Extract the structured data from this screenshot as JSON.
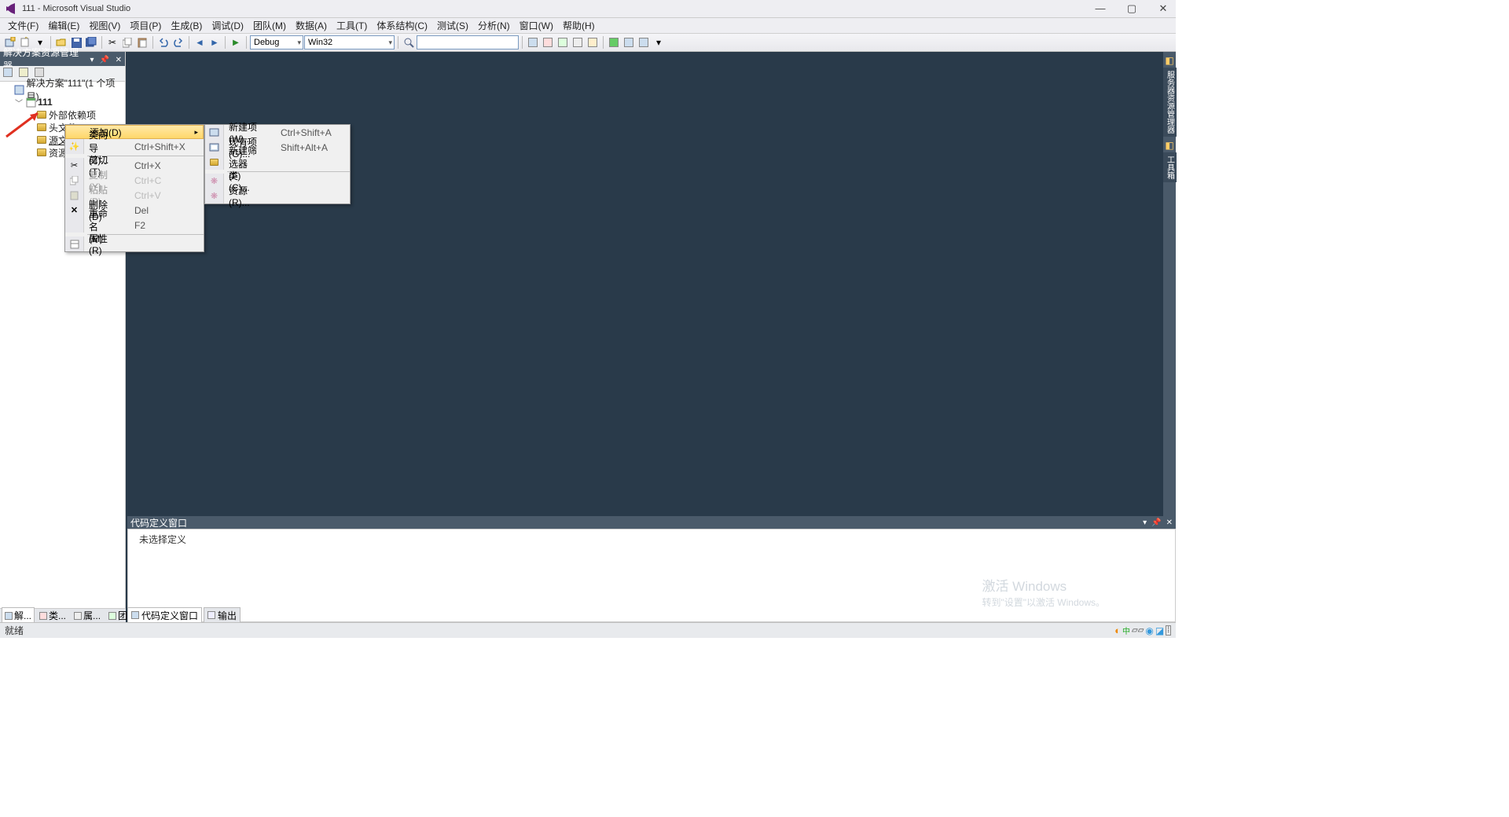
{
  "title": "111 - Microsoft Visual Studio",
  "menubar": [
    "文件(F)",
    "编辑(E)",
    "视图(V)",
    "项目(P)",
    "生成(B)",
    "调试(D)",
    "团队(M)",
    "数据(A)",
    "工具(T)",
    "体系结构(C)",
    "测试(S)",
    "分析(N)",
    "窗口(W)",
    "帮助(H)"
  ],
  "toolbar": {
    "config": "Debug",
    "platform": "Win32"
  },
  "solution_explorer": {
    "title": "解决方案资源管理器",
    "solution": "解决方案\"111\"(1 个项目)",
    "project": "111",
    "folders": [
      "外部依赖项",
      "头文件",
      "源文(",
      "资源"
    ]
  },
  "context_menu_1": [
    {
      "label": "添加(D)",
      "shortcut": "",
      "arrow": true,
      "highlighted": true,
      "icon": ""
    },
    {
      "label": "类向导(Z)...",
      "shortcut": "Ctrl+Shift+X",
      "icon": "wand"
    },
    {
      "sep": true
    },
    {
      "label": "剪切(T)",
      "shortcut": "Ctrl+X",
      "icon": "cut"
    },
    {
      "label": "复制(Y)",
      "shortcut": "Ctrl+C",
      "icon": "copy",
      "disabled": true
    },
    {
      "label": "粘贴(P)",
      "shortcut": "Ctrl+V",
      "icon": "paste",
      "disabled": true
    },
    {
      "label": "删除(D)",
      "shortcut": "Del",
      "icon": "delete"
    },
    {
      "label": "重命名(M)",
      "shortcut": "F2",
      "icon": ""
    },
    {
      "sep": true
    },
    {
      "label": "属性(R)",
      "shortcut": "",
      "icon": "props"
    }
  ],
  "context_menu_2": [
    {
      "label": "新建项(W)...",
      "shortcut": "Ctrl+Shift+A",
      "icon": "newitem"
    },
    {
      "label": "现有项(G)...",
      "shortcut": "Shift+Alt+A",
      "icon": "existitem"
    },
    {
      "label": "新建筛选器(F)",
      "shortcut": "",
      "icon": "folder"
    },
    {
      "sep": true
    },
    {
      "label": "类(C)...",
      "shortcut": "",
      "icon": "class"
    },
    {
      "label": "资源(R)...",
      "shortcut": "",
      "icon": "resource"
    }
  ],
  "code_def": {
    "title": "代码定义窗口",
    "body": "未选择定义"
  },
  "bottom_tabs_left": [
    "解...",
    "类...",
    "属...",
    "团..."
  ],
  "bottom_tabs_right": [
    "代码定义窗口",
    "输出"
  ],
  "status": {
    "left": "就绪"
  },
  "watermark": {
    "line1": "激活 Windows",
    "line2": "转到\"设置\"以激活 Windows。"
  },
  "right_tabs": [
    "服务器资源管理器",
    "工具箱"
  ]
}
